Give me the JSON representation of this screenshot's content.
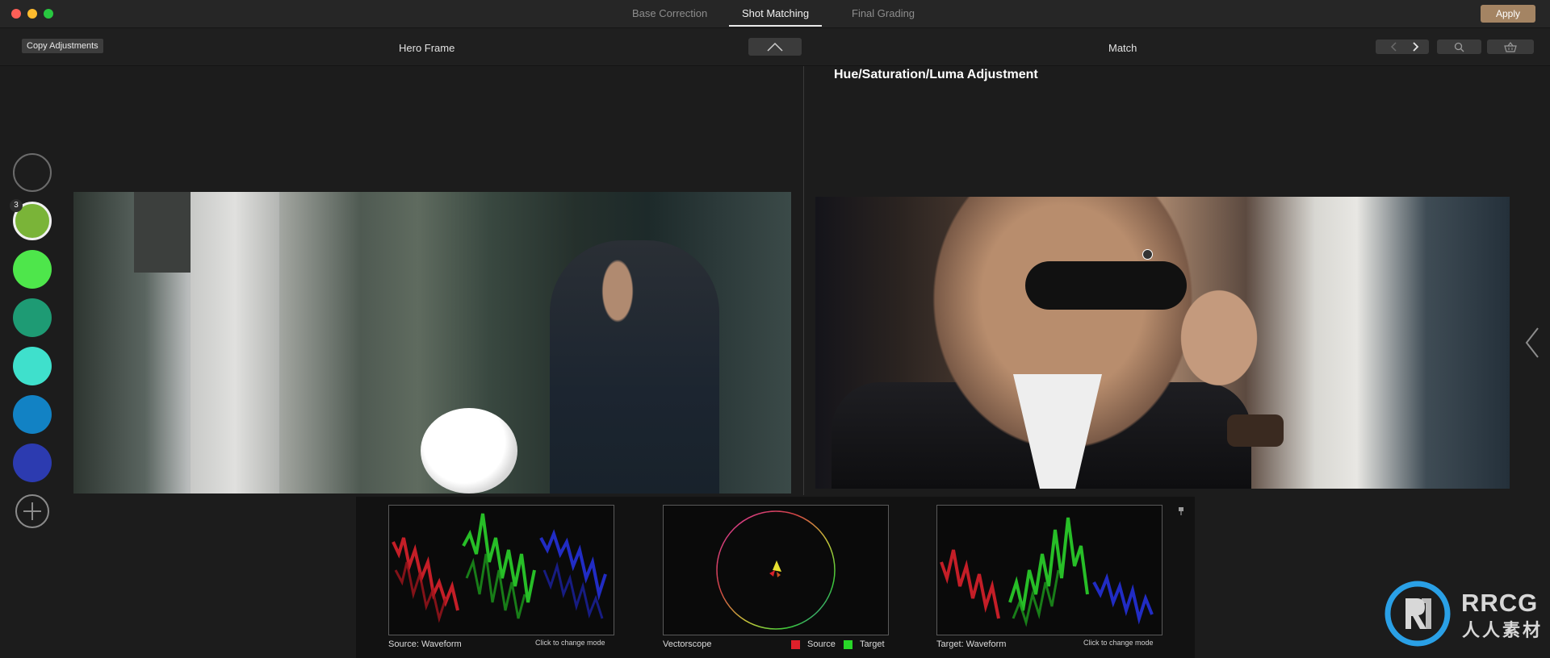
{
  "tabs": [
    {
      "label": "Base Correction",
      "active": false
    },
    {
      "label": "Shot Matching",
      "active": true
    },
    {
      "label": "Final Grading",
      "active": false
    }
  ],
  "apply_label": "Apply",
  "toolbar": {
    "copy_adjustments": "Copy Adjustments",
    "hero_label": "Hero Frame",
    "match_label": "Match"
  },
  "section_title": "Hue/Saturation/Luma Adjustment",
  "swatches": {
    "badge": "3",
    "colors": [
      "#1d1d1d",
      "#7ab438",
      "#4ee64b",
      "#1e9b74",
      "#3fe0cc",
      "#1282c4",
      "#2c3bb0"
    ]
  },
  "scopes": {
    "source_label": "Source: Waveform",
    "source_hint": "Click to change mode",
    "vectorscope_label": "Vectorscope",
    "legend_source": "Source",
    "legend_target": "Target",
    "legend_source_color": "#e0202a",
    "legend_target_color": "#28d628",
    "target_label": "Target: Waveform",
    "target_hint": "Click to change mode"
  },
  "watermark": {
    "brand": "RRCG",
    "sub": "人人素材"
  }
}
